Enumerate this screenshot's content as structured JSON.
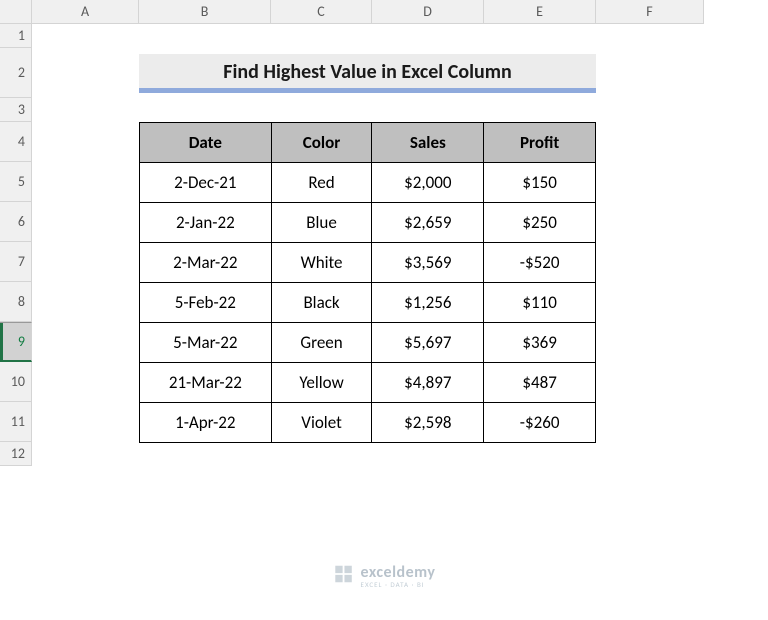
{
  "columns": [
    "A",
    "B",
    "C",
    "D",
    "E",
    "F"
  ],
  "rows": [
    "1",
    "2",
    "3",
    "4",
    "5",
    "6",
    "7",
    "8",
    "9",
    "10",
    "11",
    "12"
  ],
  "selected_row": "9",
  "title": "Find Highest Value in Excel Column",
  "headers": {
    "date": "Date",
    "color": "Color",
    "sales": "Sales",
    "profit": "Profit"
  },
  "data": [
    {
      "date": "2-Dec-21",
      "color": "Red",
      "sales": "$2,000",
      "profit": "$150"
    },
    {
      "date": "2-Jan-22",
      "color": "Blue",
      "sales": "$2,659",
      "profit": "$250"
    },
    {
      "date": "2-Mar-22",
      "color": "White",
      "sales": "$3,569",
      "profit": "-$520"
    },
    {
      "date": "5-Feb-22",
      "color": "Black",
      "sales": "$1,256",
      "profit": "$110"
    },
    {
      "date": "5-Mar-22",
      "color": "Green",
      "sales": "$5,697",
      "profit": "$369"
    },
    {
      "date": "21-Mar-22",
      "color": "Yellow",
      "sales": "$4,897",
      "profit": "$487"
    },
    {
      "date": "1-Apr-22",
      "color": "Violet",
      "sales": "$2,598",
      "profit": "-$260"
    }
  ],
  "watermark": {
    "name": "exceldemy",
    "sub": "EXCEL · DATA · BI"
  },
  "chart_data": {
    "type": "table",
    "title": "Find Highest Value in Excel Column",
    "columns": [
      "Date",
      "Color",
      "Sales",
      "Profit"
    ],
    "rows": [
      [
        "2-Dec-21",
        "Red",
        2000,
        150
      ],
      [
        "2-Jan-22",
        "Blue",
        2659,
        250
      ],
      [
        "2-Mar-22",
        "White",
        3569,
        -520
      ],
      [
        "5-Feb-22",
        "Black",
        1256,
        110
      ],
      [
        "5-Mar-22",
        "Green",
        5697,
        369
      ],
      [
        "21-Mar-22",
        "Yellow",
        4897,
        487
      ],
      [
        "1-Apr-22",
        "Violet",
        2598,
        -260
      ]
    ]
  }
}
